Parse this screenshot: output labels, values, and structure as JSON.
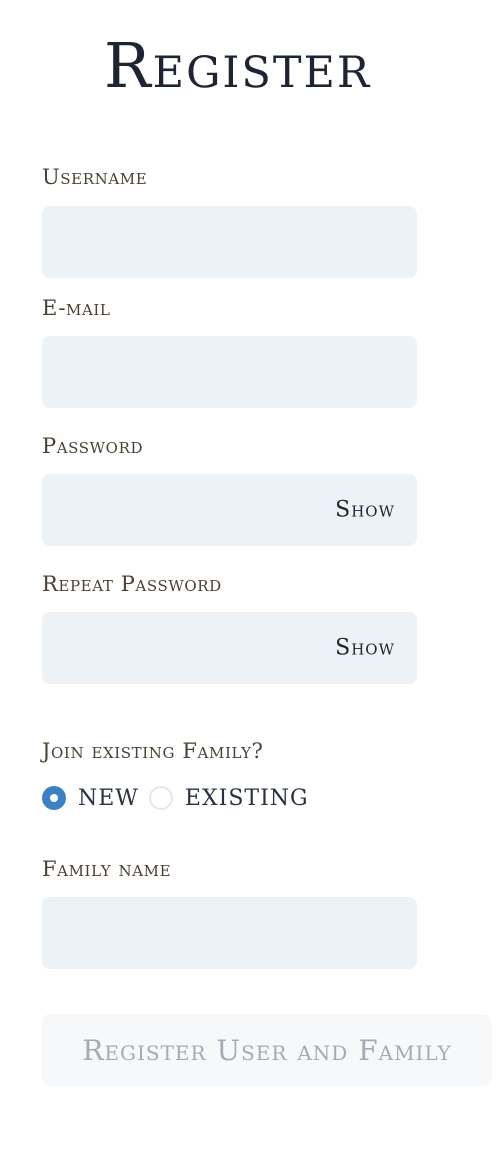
{
  "page": {
    "title": "Register"
  },
  "form": {
    "username": {
      "label": "Username",
      "value": ""
    },
    "email": {
      "label": "E-mail",
      "value": ""
    },
    "password": {
      "label": "Password",
      "value": "",
      "toggle_label": "Show"
    },
    "repeat_password": {
      "label": "Repeat Password",
      "value": "",
      "toggle_label": "Show"
    },
    "family_choice": {
      "question": "Join existing Family?",
      "options": [
        {
          "label": "NEW",
          "selected": true
        },
        {
          "label": "EXISTING",
          "selected": false
        }
      ]
    },
    "family_name": {
      "label": "Family name",
      "value": ""
    },
    "submit_label": "Register User and Family"
  },
  "colors": {
    "field_background": "#edf2f7",
    "radio_selected": "#3b82c4",
    "submit_disabled_background": "#f6f8fa",
    "submit_disabled_text": "#a5abb3"
  }
}
